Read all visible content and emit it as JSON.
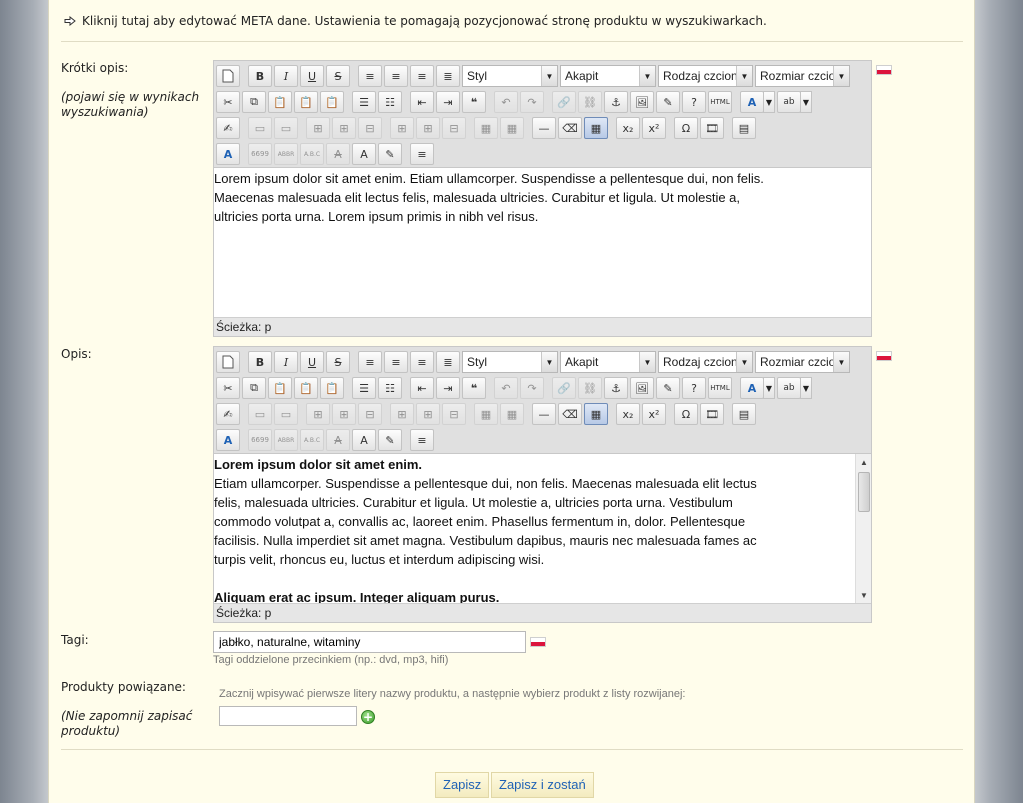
{
  "meta": {
    "link_text": "Kliknij tutaj aby edytować META dane. Ustawienia te pomagają pozycjonować stronę produktu w wyszukiwarkach."
  },
  "short_desc": {
    "label": "Krótki opis:",
    "hint": "(pojawi się w wynikach wyszukiwania)",
    "content": [
      "Lorem ipsum dolor sit amet enim. Etiam ullamcorper. Suspendisse a pellentesque dui, non felis.",
      "Maecenas malesuada elit lectus felis, malesuada ultricies. Curabitur et ligula. Ut molestie a,",
      "ultricies porta urna. Lorem ipsum primis in nibh vel risus."
    ],
    "path": "Ścieżka: p"
  },
  "description": {
    "label": "Opis:",
    "heading": "Lorem ipsum dolor sit amet enim.",
    "content": [
      "Etiam ullamcorper. Suspendisse a pellentesque dui, non felis. Maecenas malesuada elit lectus",
      "felis, malesuada ultricies. Curabitur et ligula. Ut molestie a, ultricies porta urna. Vestibulum",
      "commodo volutpat a, convallis ac, laoreet enim. Phasellus fermentum in, dolor. Pellentesque",
      "facilisis. Nulla imperdiet sit amet magna. Vestibulum dapibus, mauris nec malesuada fames ac",
      "turpis velit, rhoncus eu, luctus et interdum adipiscing wisi."
    ],
    "heading2": "Aliquam erat ac ipsum. Integer aliquam purus.",
    "path": "Ścieżka: p"
  },
  "toolbar": {
    "style_label": "Styl",
    "format_label": "Akapit",
    "font_label": "Rodzaj czcionki",
    "size_label": "Rozmiar czcionki"
  },
  "tags": {
    "label": "Tagi:",
    "value": "jabłko, naturalne, witaminy",
    "note": "Tagi oddzielone przecinkiem (np.: dvd, mp3, hifi)"
  },
  "related": {
    "label": "Produkty powiązane:",
    "hint": "(Nie zapomnij zapisać produktu)",
    "note": "Zacznij wpisywać pierwsze litery nazwy produktu, a następnie wybierz produkt z listy rozwijanej:",
    "value": ""
  },
  "buttons": {
    "save": "Zapisz",
    "save_stay": "Zapisz i zostań"
  },
  "colors": {
    "panel_bg": "#fffdeb",
    "link_blue": "#1f62b5",
    "flag_red": "#dc143c"
  }
}
